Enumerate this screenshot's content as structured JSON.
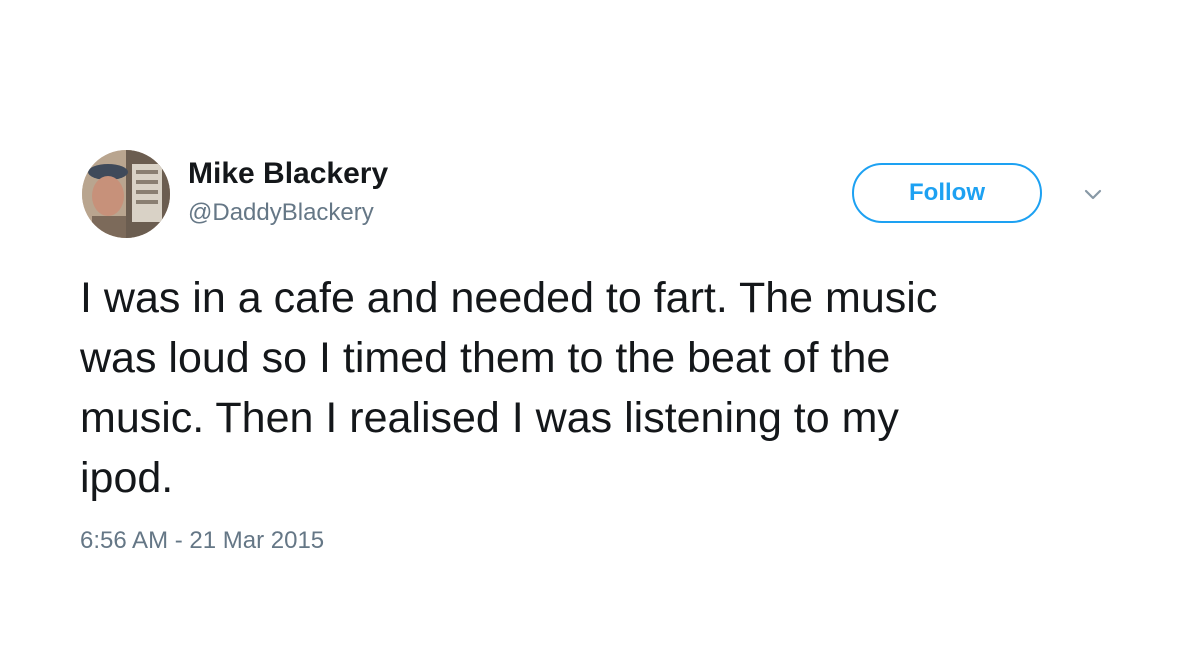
{
  "tweet": {
    "author": {
      "display_name": "Mike Blackery",
      "handle": "@DaddyBlackery"
    },
    "follow_label": "Follow",
    "text_lines": [
      "I was in a cafe and needed to fart. The music",
      "was loud so I timed them to the beat of the",
      "music. Then I realised I was listening to my",
      "ipod."
    ],
    "timestamp": "6:56 AM - 21 Mar 2015",
    "icons": {
      "avatar": "profile-photo",
      "more": "chevron-down-icon"
    },
    "colors": {
      "accent": "#1da1f2",
      "text": "#14171a",
      "muted": "#657786"
    }
  }
}
